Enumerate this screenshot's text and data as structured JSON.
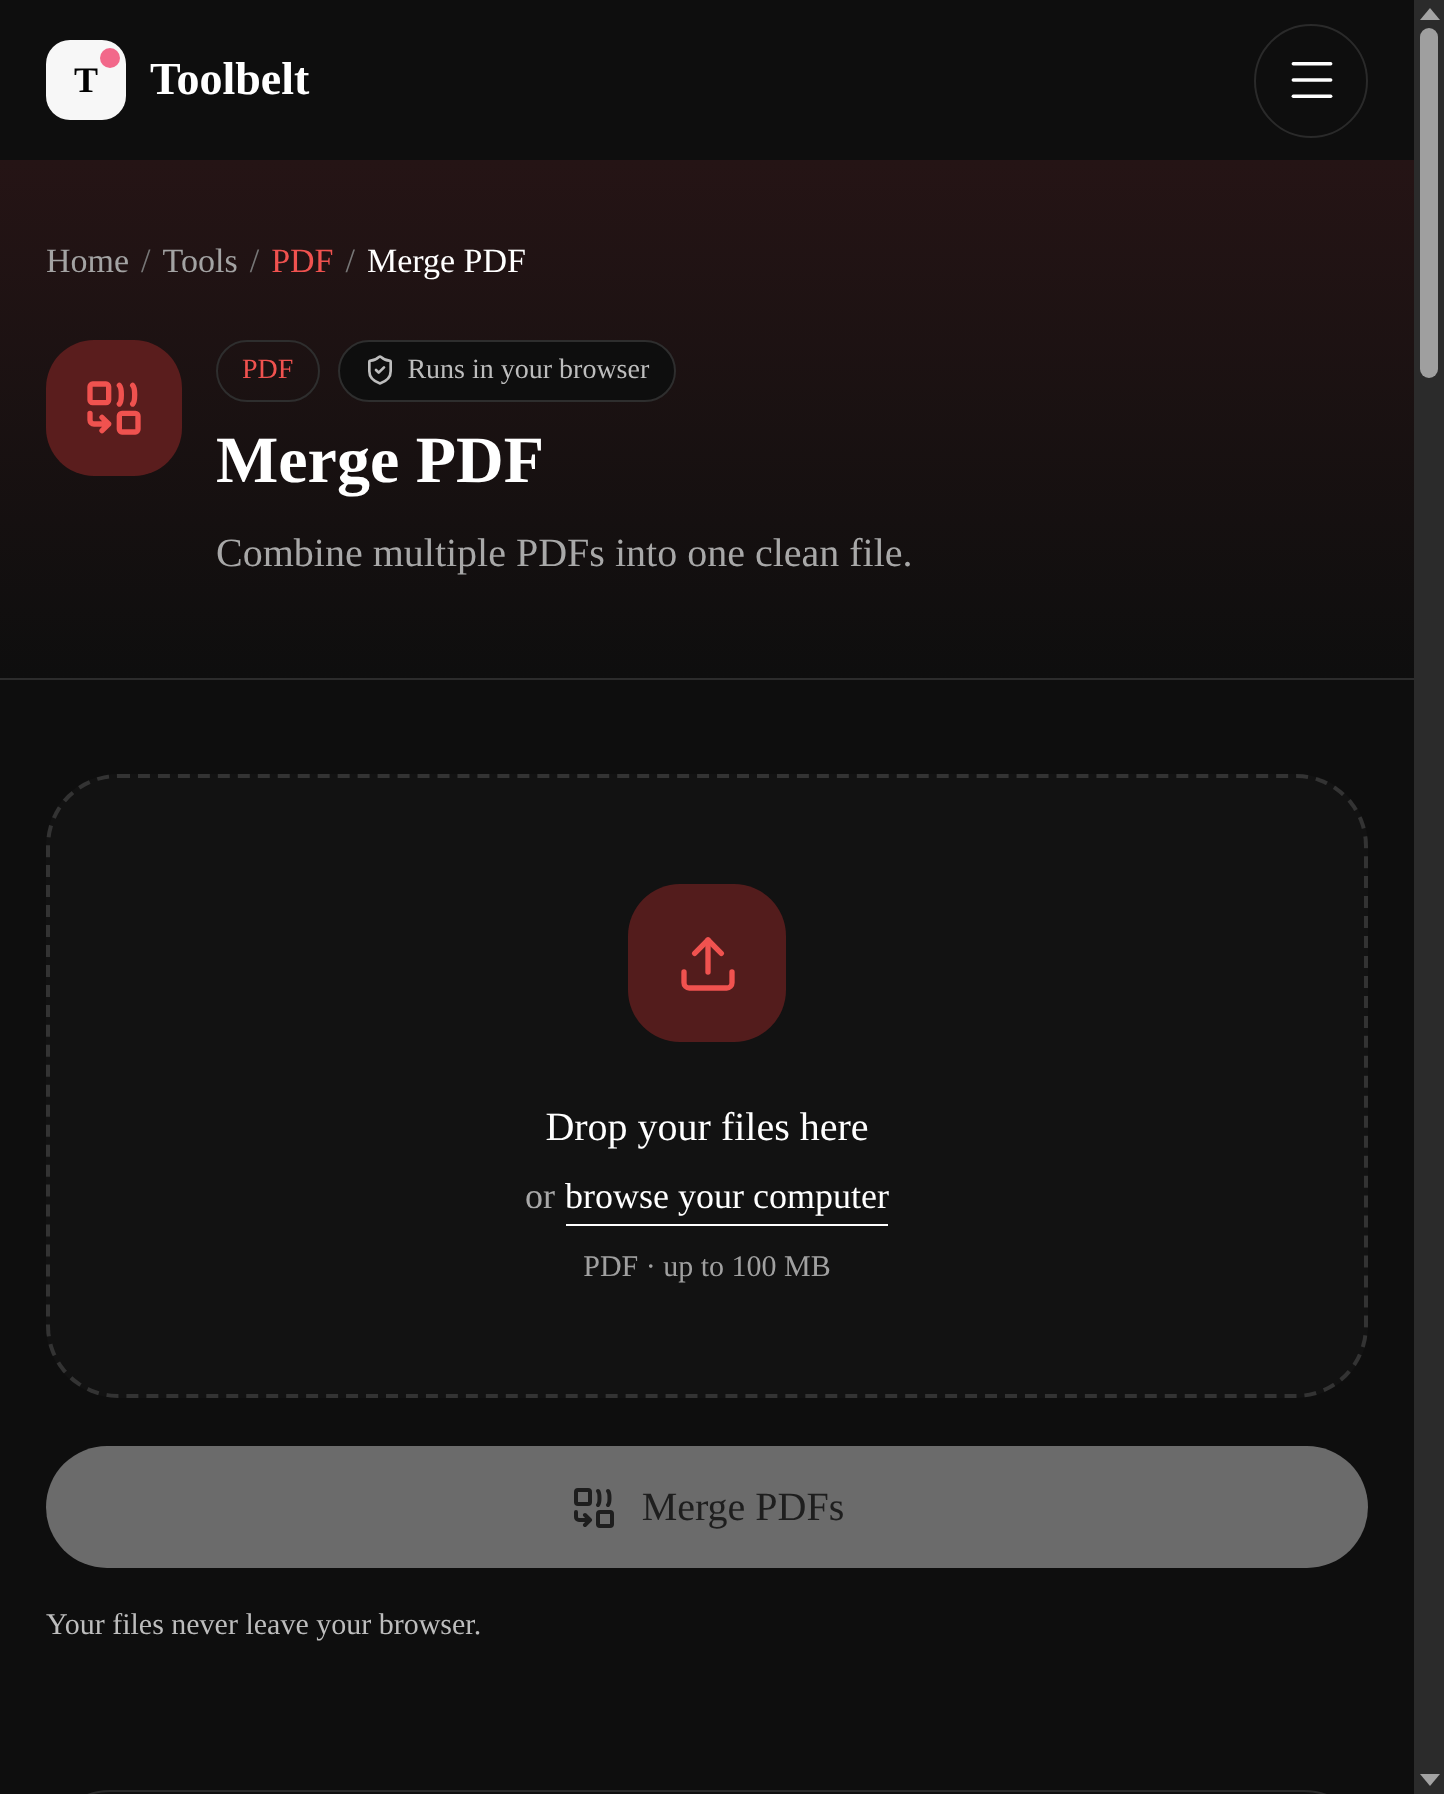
{
  "header": {
    "logo_letter": "T",
    "brand": "Toolbelt"
  },
  "breadcrumb": [
    {
      "label": "Home",
      "kind": "link"
    },
    {
      "label": "Tools",
      "kind": "link"
    },
    {
      "label": "PDF",
      "kind": "category"
    },
    {
      "label": "Merge PDF",
      "kind": "current"
    }
  ],
  "separator": "/",
  "badges": [
    {
      "label": "PDF",
      "kind": "category"
    },
    {
      "label": "Runs in your browser",
      "kind": "secure"
    }
  ],
  "title": "Merge PDF",
  "subtitle": "Combine multiple PDFs into one clean file.",
  "dropzone": {
    "heading": "Drop your files here",
    "prefix": "or",
    "link": "browse your computer",
    "hint": "PDF · up to 100 MB"
  },
  "action": {
    "label": "Merge PDFs",
    "disabled": true
  },
  "note": "Your files never leave your browser."
}
